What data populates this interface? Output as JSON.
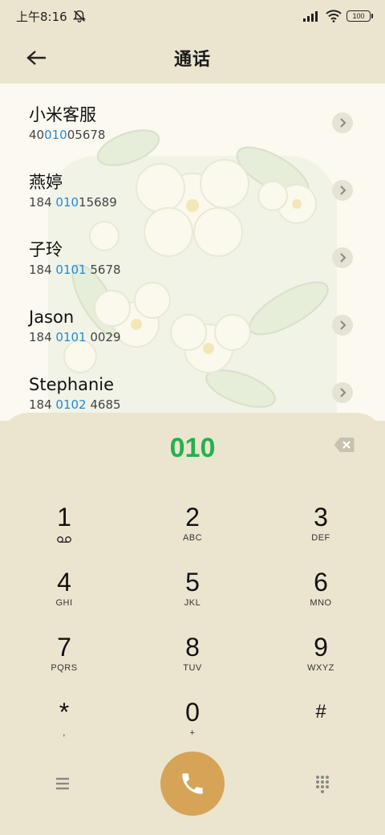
{
  "status_bar": {
    "time": "上午8:16",
    "battery": "100"
  },
  "header": {
    "title": "通话"
  },
  "contacts": [
    {
      "name": "小米客服",
      "number_pre": "40",
      "number_hl": "010",
      "number_post": "05678"
    },
    {
      "name": "燕婷",
      "number_pre": "184 ",
      "number_hl": "010",
      "number_post": "15689"
    },
    {
      "name": "子玲",
      "number_pre": "184 ",
      "number_hl": "0101",
      "number_post": " 5678"
    },
    {
      "name": "Jason",
      "number_pre": "184 ",
      "number_hl": "0101",
      "number_post": " 0029"
    },
    {
      "name": "Stephanie",
      "number_pre": "184 ",
      "number_hl": "0102",
      "number_post": " 4685"
    }
  ],
  "dialer": {
    "input": "010",
    "keys": [
      {
        "digit": "1",
        "letters": ""
      },
      {
        "digit": "2",
        "letters": "ABC"
      },
      {
        "digit": "3",
        "letters": "DEF"
      },
      {
        "digit": "4",
        "letters": "GHI"
      },
      {
        "digit": "5",
        "letters": "JKL"
      },
      {
        "digit": "6",
        "letters": "MNO"
      },
      {
        "digit": "7",
        "letters": "PQRS"
      },
      {
        "digit": "8",
        "letters": "TUV"
      },
      {
        "digit": "9",
        "letters": "WXYZ"
      },
      {
        "digit": "*",
        "letters": ","
      },
      {
        "digit": "0",
        "letters": "+"
      },
      {
        "digit": "#",
        "letters": ""
      }
    ]
  },
  "colors": {
    "highlight": "#1f8ad8",
    "dial_input": "#22b24c",
    "call_button": "#d6a456",
    "background": "#ebe5cf"
  }
}
